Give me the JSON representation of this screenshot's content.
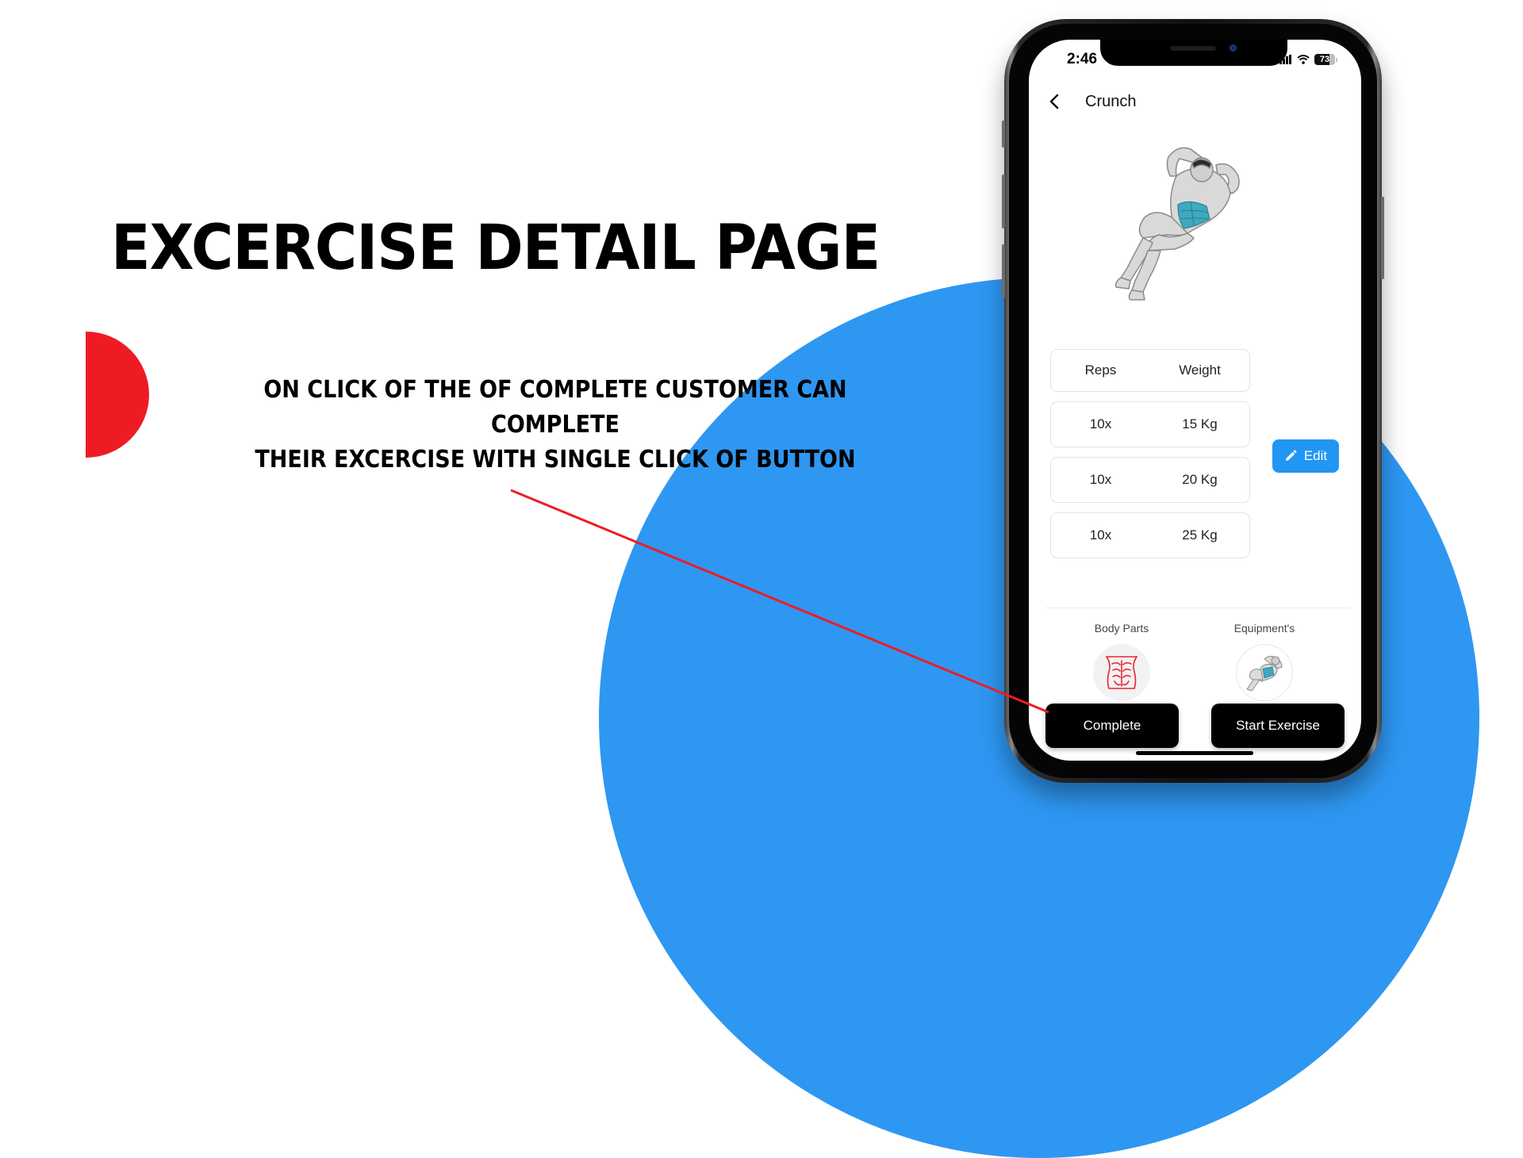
{
  "slide": {
    "headline": "EXCERCISE DETAIL PAGE",
    "caption_line1": "ON CLICK OF THE OF COMPLETE CUSTOMER CAN COMPLETE",
    "caption_line2": "THEIR EXCERCISE WITH SINGLE CLICK OF BUTTON",
    "colors": {
      "accent_red": "#ED1C24",
      "accent_blue": "#2E97F2"
    }
  },
  "status_bar": {
    "time": "2:46",
    "battery": "73"
  },
  "nav": {
    "back_icon": "chevron-left-icon",
    "title": "Crunch"
  },
  "exercise": {
    "image": "crunch-figure"
  },
  "sets": {
    "headers": [
      "Reps",
      "Weight"
    ],
    "rows": [
      {
        "reps": "10x",
        "weight": "15 Kg"
      },
      {
        "reps": "10x",
        "weight": "20 Kg"
      },
      {
        "reps": "10x",
        "weight": "25 Kg"
      }
    ]
  },
  "edit_button": {
    "label": "Edit",
    "icon": "pencil-icon",
    "color": "#2196F3"
  },
  "info": {
    "body_parts_label": "Body Parts",
    "body_parts_icon": "abs-icon",
    "equipment_label": "Equipment's",
    "equipment_icon": "crunch-thumbnail"
  },
  "actions": {
    "complete_label": "Complete",
    "start_label": "Start Exercise"
  }
}
